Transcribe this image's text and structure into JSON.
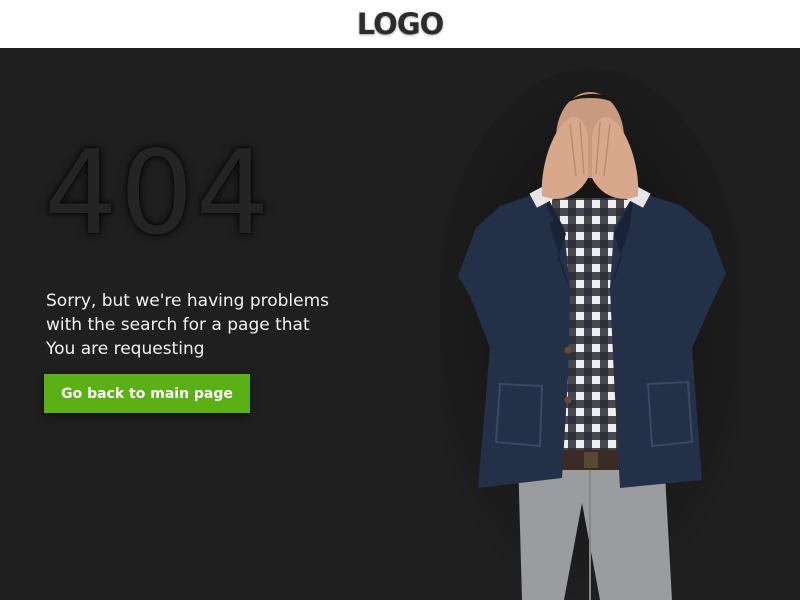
{
  "header": {
    "logo_text": "LOGO"
  },
  "error": {
    "code": "404",
    "message_lines": [
      "Sorry, but we're having problems",
      "with the search for a page that",
      "You are requesting"
    ]
  },
  "actions": {
    "back_button_label": "Go back to main page"
  },
  "colors": {
    "accent": "#5ab014",
    "background": "#1f1f1f",
    "header_background": "#ffffff"
  },
  "illustration": {
    "subject": "man-covering-eyes"
  }
}
